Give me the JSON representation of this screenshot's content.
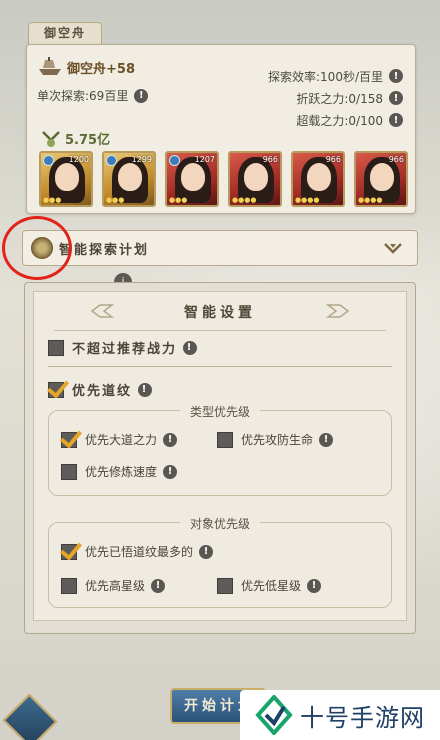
{
  "ship": {
    "tab_title": "御空舟",
    "ship_name": "御空舟+58",
    "single_explore": "单次探索:69百里",
    "explore_efficiency": "探索效率:100秒/百里",
    "leap_power": "折跃之力:0/158",
    "overload_power": "超载之力:0/100",
    "power_value": "5.75亿",
    "heroes": [
      {
        "level": "1200",
        "frame": "gold"
      },
      {
        "level": "1299",
        "frame": "gold"
      },
      {
        "level": "1207",
        "frame": "red"
      },
      {
        "level": "966",
        "frame": "red"
      },
      {
        "level": "966",
        "frame": "red"
      },
      {
        "level": "966",
        "frame": "red"
      }
    ]
  },
  "plan": {
    "title": "智能探索计划",
    "info_mark": "i"
  },
  "settings": {
    "title": "智能设置",
    "not_exceed": {
      "label": "不超过推荐战力",
      "checked": false
    },
    "prefer_dao": {
      "label": "优先道纹",
      "checked": true
    },
    "type_priority": {
      "label": "类型优先级",
      "dao_power": {
        "label": "优先大道之力",
        "checked": true
      },
      "atk_def_life": {
        "label": "优先攻防生命",
        "checked": false
      },
      "cultivation_speed": {
        "label": "优先修炼速度",
        "checked": false
      }
    },
    "target_priority": {
      "label": "对象优先级",
      "most_dao": {
        "label": "优先已悟道纹最多的",
        "checked": true
      },
      "high_star": {
        "label": "优先高星级",
        "checked": false
      },
      "low_star": {
        "label": "优先低星级",
        "checked": false
      }
    }
  },
  "footer": {
    "start_button": "开始计划",
    "watermark": "十号手游网"
  },
  "colors": {
    "checkbox_tick": "#e3a52a",
    "highlight_circle": "#e2231a",
    "button_blue": "#2b5377"
  }
}
